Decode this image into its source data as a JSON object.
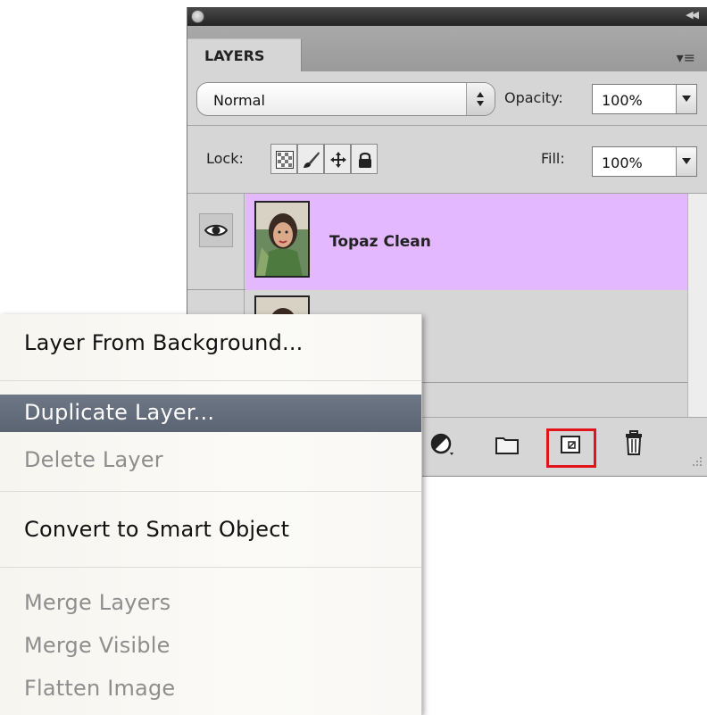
{
  "panel": {
    "tab_label": "LAYERS",
    "blend_mode": "Normal",
    "opacity_label": "Opacity:",
    "opacity_value": "100%",
    "lock_label": "Lock:",
    "fill_label": "Fill:",
    "fill_value": "100%",
    "lock_icons": [
      "transparency-lock-icon",
      "brush-lock-icon",
      "move-lock-icon",
      "padlock-icon"
    ],
    "layers": [
      {
        "name": "Topaz Clean",
        "visible": true,
        "selected": true
      },
      {
        "name": "",
        "visible": false,
        "selected": false
      }
    ],
    "bottom_icons": [
      "adjustment-layer-icon",
      "folder-icon",
      "new-layer-icon",
      "trash-icon"
    ],
    "selection_color": "#e3b8fe",
    "highlight_color": "#e0141a"
  },
  "menu": {
    "items": [
      {
        "label": "Layer From Background...",
        "enabled": true
      },
      {
        "label": "Duplicate Layer...",
        "enabled": true,
        "highlighted": true
      },
      {
        "label": "Delete Layer",
        "enabled": false
      },
      {
        "label": "Convert to Smart Object",
        "enabled": true
      },
      {
        "label": "Merge Layers",
        "enabled": false
      },
      {
        "label": "Merge Visible",
        "enabled": false
      },
      {
        "label": "Flatten Image",
        "enabled": false
      }
    ]
  }
}
